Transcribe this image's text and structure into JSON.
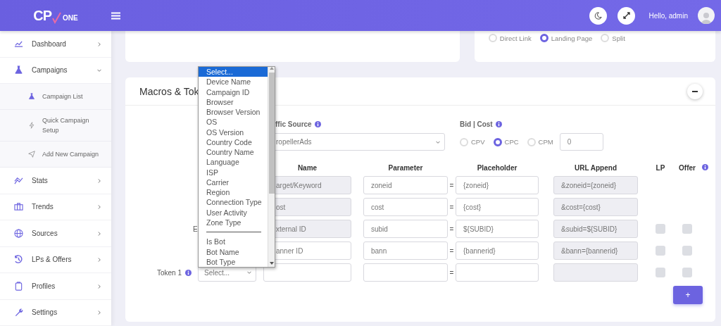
{
  "header": {
    "logo_mark": "CP",
    "logo_name": "ONE",
    "greeting": "Hello, admin"
  },
  "sidebar": {
    "items": [
      {
        "label": "Dashboard",
        "expanded": false
      },
      {
        "label": "Campaigns",
        "expanded": true,
        "children": [
          {
            "label": "Campaign List"
          },
          {
            "label": "Quick Campaign Setup"
          },
          {
            "label": "Add New Campaign"
          }
        ]
      },
      {
        "label": "Stats",
        "expanded": false
      },
      {
        "label": "Trends",
        "expanded": false
      },
      {
        "label": "Sources",
        "expanded": false
      },
      {
        "label": "LPs & Offers",
        "expanded": false
      },
      {
        "label": "Profiles",
        "expanded": false
      },
      {
        "label": "Settings",
        "expanded": false
      }
    ]
  },
  "flow_options": [
    {
      "label": "Direct Link",
      "selected": false
    },
    {
      "label": "Landing Page",
      "selected": true
    },
    {
      "label": "Split",
      "selected": false
    }
  ],
  "macros_card": {
    "title": "Macros & Tok",
    "traffic_source": {
      "label": "ffic Source",
      "value": "ropellerAds"
    },
    "bid_cost": {
      "label": "Bid | Cost",
      "options": [
        {
          "label": "CPV",
          "selected": false
        },
        {
          "label": "CPC",
          "selected": true
        },
        {
          "label": "CPM",
          "selected": false
        }
      ],
      "value": "0"
    },
    "columns": [
      "Name",
      "Parameter",
      "Placeholder",
      "URL Append",
      "LP",
      "Offer"
    ],
    "rows": [
      {
        "kind": "macro",
        "label": "",
        "name": "arget/Keyword",
        "name_locked": true,
        "parameter": "zoneid",
        "equals": "=",
        "macro_value": "{zoneid}",
        "url_append": "&zoneid={zoneid}"
      },
      {
        "kind": "macro",
        "label": "",
        "name": "ost",
        "name_locked": true,
        "parameter": "cost",
        "equals": "=",
        "macro_value": "{cost}",
        "url_append": "&cost={cost}"
      },
      {
        "kind": "macro",
        "label": "E",
        "name": "xternal ID",
        "name_locked": true,
        "parameter": "subid",
        "equals": "=",
        "macro_value": "${SUBID}",
        "url_append": "&subid=${SUBID}",
        "lp": {
          "checked": false
        },
        "offer": {
          "checked": false
        }
      },
      {
        "kind": "macro",
        "label": "",
        "name": "anner ID",
        "name_locked": false,
        "parameter": "bann",
        "equals": "=",
        "macro_value": "{bannerid}",
        "url_append": "&bann={bannerid}",
        "lp": {
          "checked": false
        },
        "offer": {
          "checked": false
        }
      },
      {
        "kind": "token",
        "label": "Token 1",
        "select": "Select...",
        "name": "",
        "name_locked": false,
        "parameter": "",
        "equals": "=",
        "macro_value": "",
        "url_append": "",
        "lp": {
          "checked": false
        },
        "offer": {
          "checked": false
        }
      }
    ],
    "add_button": "+"
  },
  "dropdown": {
    "items": [
      {
        "kind": "option",
        "label": "Select...",
        "selected": true
      },
      {
        "kind": "option",
        "label": "Device Name",
        "selected": false
      },
      {
        "kind": "option",
        "label": "Campaign ID",
        "selected": false
      },
      {
        "kind": "option",
        "label": "Browser",
        "selected": false
      },
      {
        "kind": "option",
        "label": "Browser Version",
        "selected": false
      },
      {
        "kind": "option",
        "label": "OS",
        "selected": false
      },
      {
        "kind": "option",
        "label": "OS Version",
        "selected": false
      },
      {
        "kind": "option",
        "label": "Country Code",
        "selected": false
      },
      {
        "kind": "option",
        "label": "Country Name",
        "selected": false
      },
      {
        "kind": "option",
        "label": "Language",
        "selected": false
      },
      {
        "kind": "option",
        "label": "ISP",
        "selected": false
      },
      {
        "kind": "option",
        "label": "Carrier",
        "selected": false
      },
      {
        "kind": "option",
        "label": "Region",
        "selected": false
      },
      {
        "kind": "option",
        "label": "Connection Type",
        "selected": false
      },
      {
        "kind": "option",
        "label": "User Activity",
        "selected": false
      },
      {
        "kind": "option",
        "label": "Zone Type",
        "selected": false
      },
      {
        "kind": "separator"
      },
      {
        "kind": "option",
        "label": "Is Bot",
        "selected": false
      },
      {
        "kind": "option",
        "label": "Bot Name",
        "selected": false
      },
      {
        "kind": "option",
        "label": "Bot Type",
        "selected": false
      }
    ]
  }
}
